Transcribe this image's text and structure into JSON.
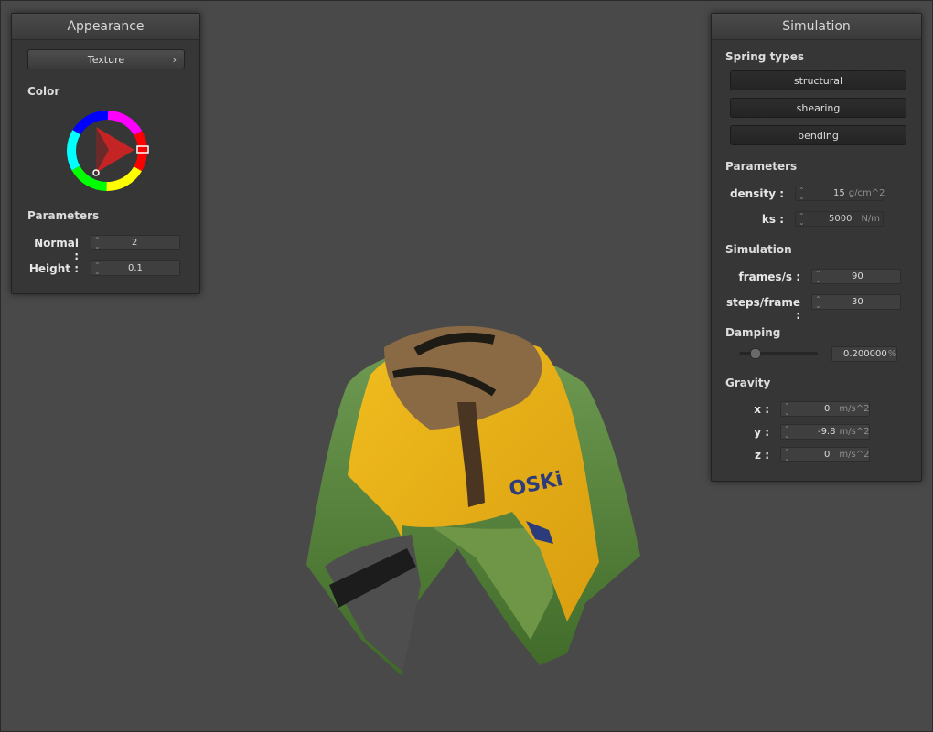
{
  "appearance": {
    "title": "Appearance",
    "shader_dropdown": "Texture",
    "color_label": "Color",
    "parameters_label": "Parameters",
    "normal_label": "Normal :",
    "normal_value": "2",
    "height_label": "Height :",
    "height_value": "0.1"
  },
  "simulation": {
    "title": "Simulation",
    "spring_types_label": "Spring types",
    "springs": [
      "structural",
      "shearing",
      "bending"
    ],
    "parameters_label": "Parameters",
    "density_label": "density :",
    "density_value": "15",
    "density_unit": "g/cm^2",
    "ks_label": "ks :",
    "ks_value": "5000",
    "ks_unit": "N/m",
    "simulation_label": "Simulation",
    "fps_label": "frames/s :",
    "fps_value": "90",
    "steps_label": "steps/frame :",
    "steps_value": "30",
    "damping_label": "Damping",
    "damping_value": "0.200000",
    "damping_unit": "%",
    "gravity_label": "Gravity",
    "gx_label": "x :",
    "gx_value": "0",
    "gy_label": "y :",
    "gy_value": "-9.8",
    "gz_label": "z :",
    "gz_value": "0",
    "g_unit": "m/s^2"
  },
  "colors": {
    "background": "#494949",
    "panel": "#363636",
    "cloth_yellow": "#e8b21c",
    "cloth_green": "#5f8a3c",
    "cloth_brown": "#6b4a2a"
  }
}
